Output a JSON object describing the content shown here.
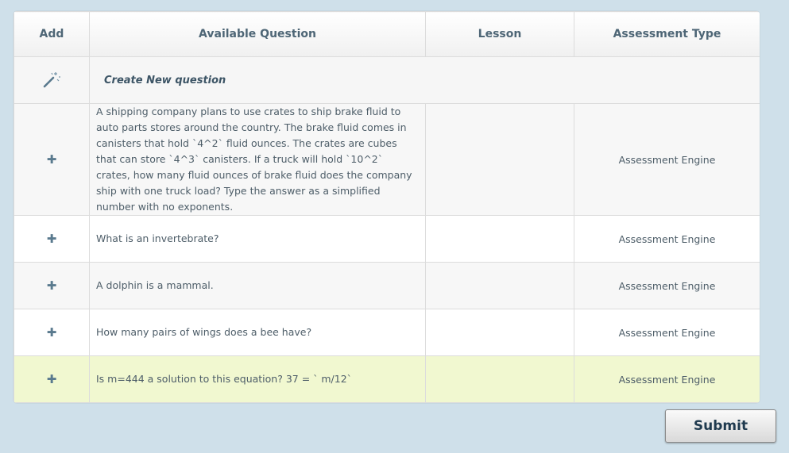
{
  "table": {
    "headers": {
      "add": "Add",
      "question": "Available Question",
      "lesson": "Lesson",
      "type": "Assessment Type"
    },
    "create_label": "Create New question",
    "rows": [
      {
        "question": "A shipping company plans to use crates to ship brake fluid to auto parts stores around the country.  The brake fluid comes in canisters that hold  `4^2`  fluid ounces.  The crates are cubes that can store  `4^3`  canisters.  If a truck will hold  `10^2`  crates, how many fluid ounces of brake fluid does the company ship with one truck load?  Type the answer as a simplified number with no exponents.",
        "lesson": "",
        "type": "Assessment Engine",
        "add_icon": "plus-icon"
      },
      {
        "question": "What is an invertebrate?",
        "lesson": "",
        "type": "Assessment Engine",
        "add_icon": "plus-icon"
      },
      {
        "question": "A dolphin is a mammal.",
        "lesson": "",
        "type": "Assessment Engine",
        "add_icon": "plus-icon"
      },
      {
        "question": "How many pairs of wings does a bee have?",
        "lesson": "",
        "type": "Assessment Engine",
        "add_icon": "plus-icon"
      },
      {
        "question": "Is m=444 a solution to this equation? 37 = ` m/12`",
        "lesson": "",
        "type": "Assessment Engine",
        "add_icon": "plus-icon"
      }
    ]
  },
  "submit_label": "Submit",
  "icons": {
    "create": "magic-wand-icon",
    "add": "plus-icon"
  },
  "colors": {
    "background": "#cfe0ea",
    "highlight_row": "#f1f8d0",
    "header_text": "#4e6676"
  }
}
